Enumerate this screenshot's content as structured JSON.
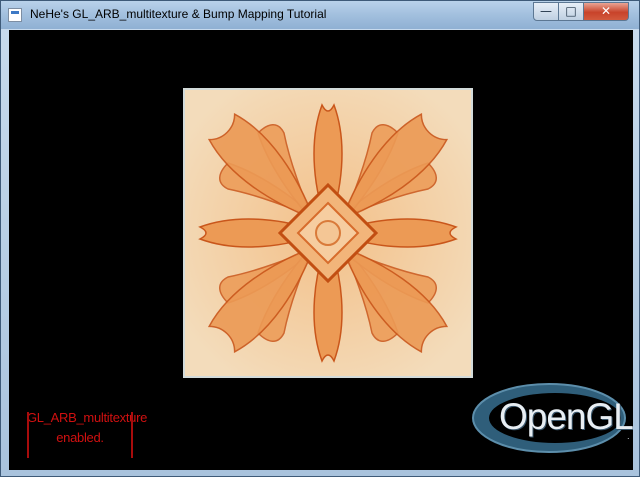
{
  "window": {
    "title": "NeHe's GL_ARB_multitexture & Bump Mapping Tutorial",
    "controls": {
      "minimize": "—",
      "maximize": "□",
      "close": "✕"
    }
  },
  "canvas": {
    "background": "#000000",
    "texture_colors": {
      "base": "#f0d2a6",
      "petal": "#ec9a55",
      "dark": "#c9561b"
    },
    "status": {
      "line1": "GL_ARB_multitexture",
      "line2": "enabled.",
      "color": "#d01010"
    },
    "logo": {
      "text": "OpenGL",
      "tm": "."
    }
  },
  "icons": {
    "app": "window-icon",
    "minimize": "minimize-icon",
    "maximize": "maximize-icon",
    "close": "close-icon"
  }
}
